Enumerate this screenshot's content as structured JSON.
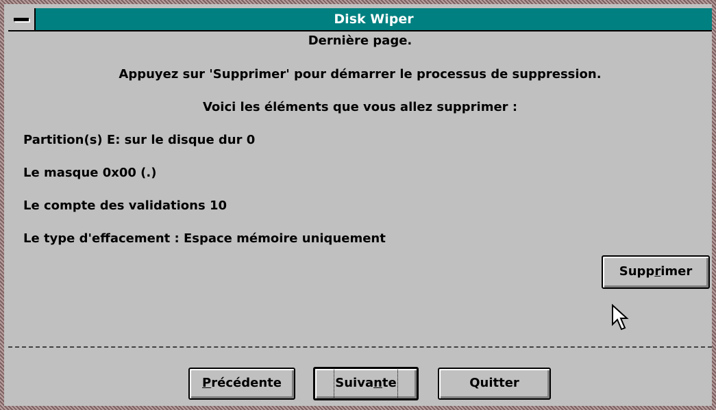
{
  "window": {
    "title": "Disk Wiper",
    "system_menu_icon": "dash-icon"
  },
  "summary": {
    "heading": "Dernière page.",
    "instruction": "Appuyez sur 'Supprimer' pour démarrer le processus de suppression.",
    "intro": "Voici les éléments que vous allez supprimer :",
    "items": [
      "Partition(s) E: sur le disque dur 0",
      "Le masque 0x00 (.)",
      "Le compte des validations 10",
      "Le type d'effacement : Espace mémoire uniquement"
    ]
  },
  "actions": {
    "delete_label": "Supprimer",
    "delete_mnemonic": "r"
  },
  "navigation": {
    "previous_label": "Précédente",
    "next_label": "Suivante",
    "quit_label": "Quitter"
  },
  "colors": {
    "titlebar": "#008080",
    "face": "#c0c0c0"
  }
}
